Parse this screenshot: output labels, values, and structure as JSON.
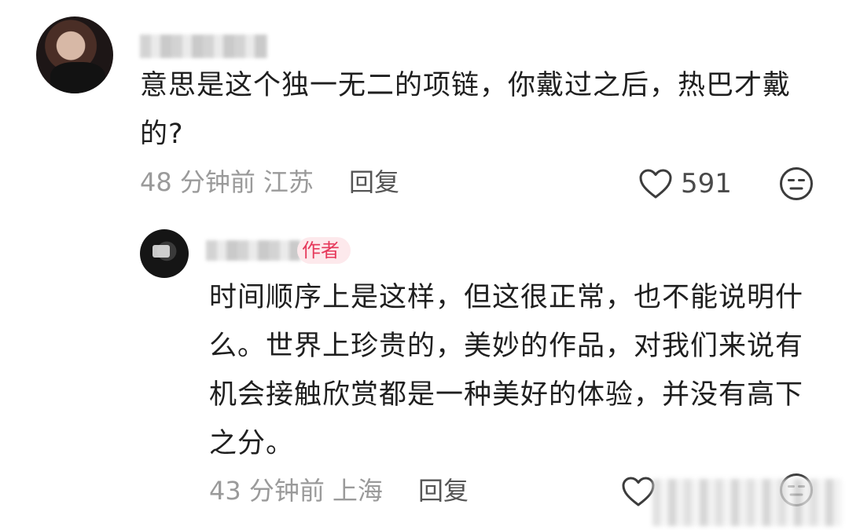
{
  "comment": {
    "text": "意思是这个独一无二的项链，你戴过之后，热巴才戴的?",
    "time": "48 分钟前",
    "location": "江苏",
    "reply_label": "回复",
    "likes": "591"
  },
  "reply": {
    "author_badge": "作者",
    "text": "时间顺序上是这样，但这很正常，也不能说明什么。世界上珍贵的，美妙的作品，对我们来说有机会接触欣赏都是一种美好的体验，并没有高下之分。",
    "time": "43 分钟前",
    "location": "上海",
    "reply_label": "回复"
  },
  "icons": {
    "like": "heart-outline-icon",
    "dislike": "neutral-face-icon"
  },
  "colors": {
    "text": "#1f1f1f",
    "meta": "#9a9a9a",
    "author_badge_bg": "#fde9ec",
    "author_badge_text": "#e6395b"
  }
}
